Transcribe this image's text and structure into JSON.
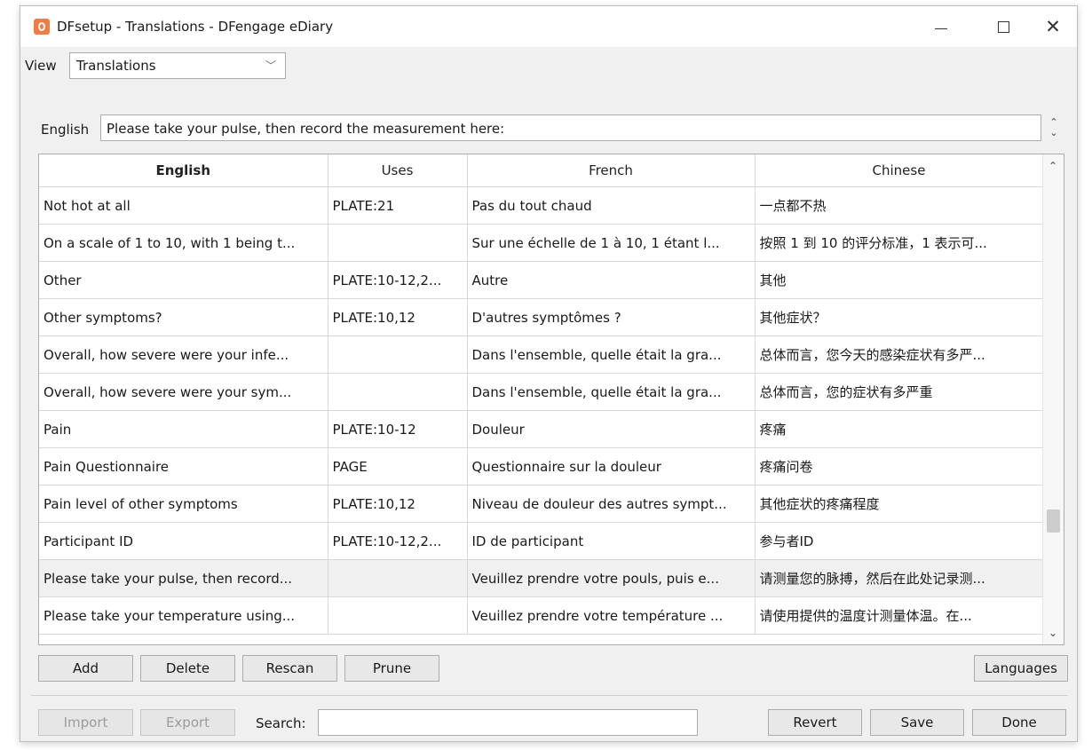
{
  "window": {
    "title": "DFsetup - Translations - DFengage eDiary"
  },
  "controls": {
    "min": "—",
    "max": "",
    "close": "✕"
  },
  "view": {
    "label": "View",
    "selected": "Translations"
  },
  "english_field": {
    "label": "English",
    "value": "Please take your pulse, then record the measurement here:"
  },
  "table": {
    "headers": [
      "English",
      "Uses",
      "French",
      "Chinese"
    ],
    "rows": [
      [
        "Not hot at all",
        "PLATE:21",
        "Pas du tout chaud",
        "一点都不热"
      ],
      [
        "On a scale of 1 to 10, with 1 being t...",
        "",
        "Sur une échelle de 1 à 10, 1 étant l...",
        "按照 1 到 10 的评分标准，1 表示可..."
      ],
      [
        "Other",
        "PLATE:10-12,2...",
        "Autre",
        "其他"
      ],
      [
        "Other symptoms?",
        "PLATE:10,12",
        "D'autres symptômes ?",
        "其他症状？"
      ],
      [
        "Overall, how severe were your infe...",
        "",
        "Dans l'ensemble, quelle était la gra...",
        "总体而言，您今天的感染症状有多严..."
      ],
      [
        "Overall, how severe were your sym...",
        "",
        "Dans l'ensemble, quelle était la gra...",
        "总体而言，您的症状有多严重"
      ],
      [
        "Pain",
        "PLATE:10-12",
        "Douleur",
        "疼痛"
      ],
      [
        "Pain Questionnaire",
        "PAGE",
        "Questionnaire sur la douleur",
        "疼痛问卷"
      ],
      [
        "Pain level of other symptoms",
        "PLATE:10,12",
        "Niveau de douleur des autres sympt...",
        "其他症状的疼痛程度"
      ],
      [
        "Participant ID",
        "PLATE:10-12,2...",
        "ID de participant",
        "参与者ID"
      ],
      [
        "Please take your pulse, then record...",
        "",
        "Veuillez prendre votre pouls, puis e...",
        "请测量您的脉搏，然后在此处记录测..."
      ],
      [
        "Please take your temperature using...",
        "",
        "Veuillez prendre votre température ...",
        "请使用提供的温度计测量体温。在..."
      ]
    ],
    "selected_row": 10
  },
  "buttons": {
    "add": "Add",
    "delete": "Delete",
    "rescan": "Rescan",
    "prune": "Prune",
    "languages": "Languages",
    "import": "Import",
    "export": "Export",
    "revert": "Revert",
    "save": "Save",
    "done": "Done"
  },
  "search": {
    "label": "Search:",
    "value": ""
  }
}
